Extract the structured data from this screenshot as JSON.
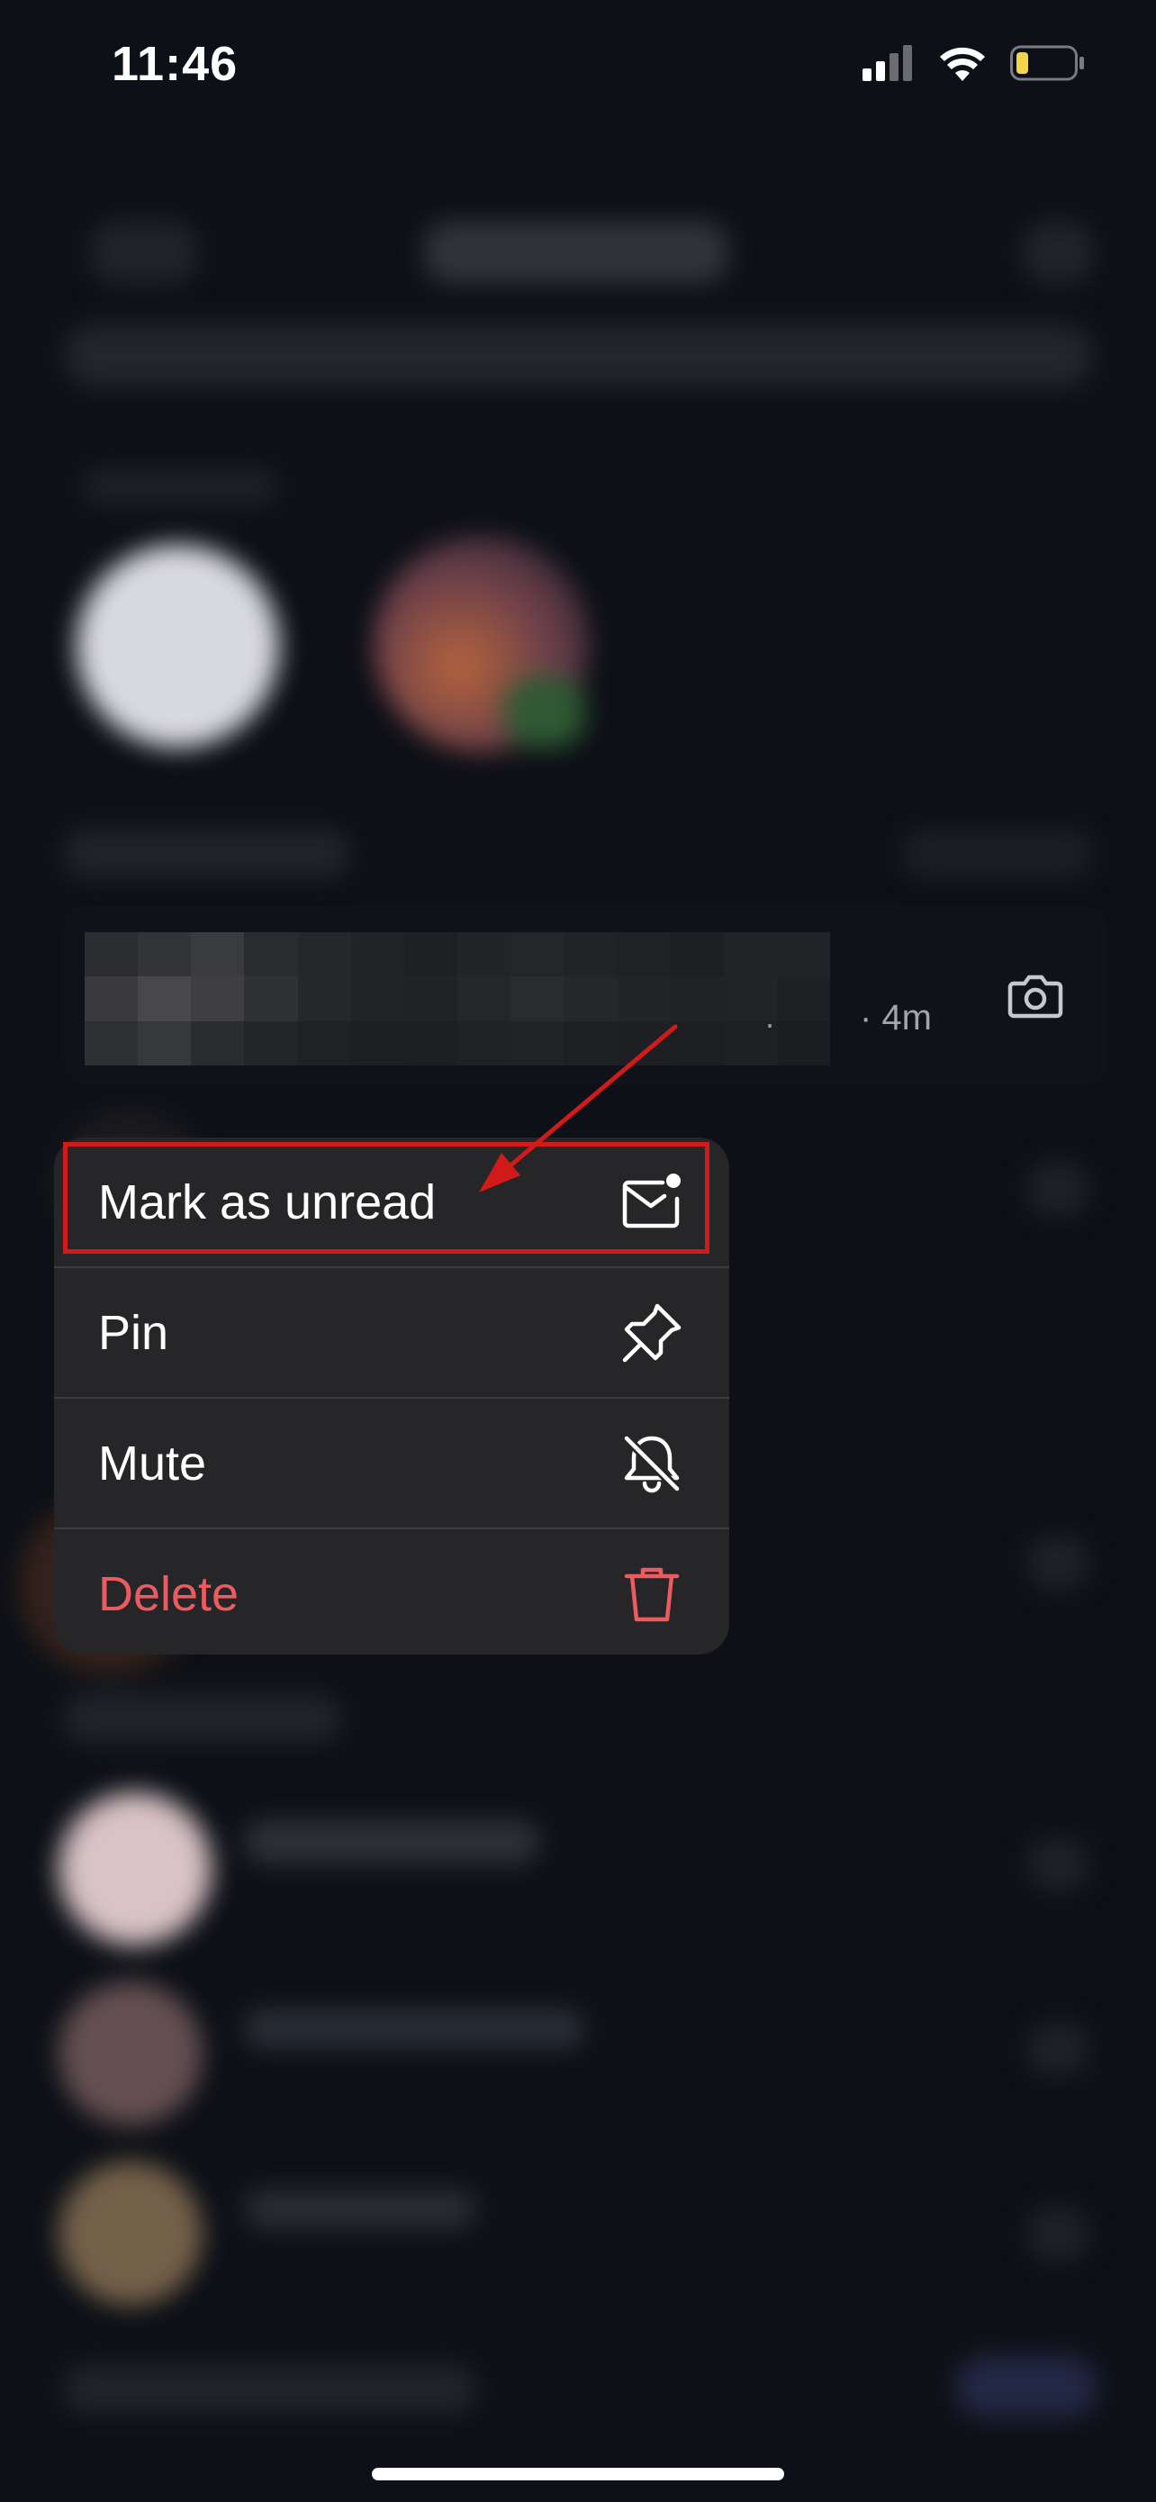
{
  "status_bar": {
    "time": "11:46",
    "icons": [
      "cellular-signal-icon",
      "wifi-icon",
      "battery-low-icon"
    ],
    "battery_color": "#f2d54b"
  },
  "conversation": {
    "ellipsis": ".",
    "time_ago": "· 4m",
    "camera_icon": "camera-icon"
  },
  "context_menu": {
    "items": [
      {
        "label": "Mark as unread",
        "icon": "mail-unread-icon"
      },
      {
        "label": "Pin",
        "icon": "pin-icon"
      },
      {
        "label": "Mute",
        "icon": "bell-slash-icon"
      },
      {
        "label": "Delete",
        "icon": "trash-icon"
      }
    ]
  },
  "colors": {
    "background": "#0d1016",
    "menu_background": "#262628",
    "delete": "#ea5c5f",
    "annotation": "#d11a1a"
  }
}
